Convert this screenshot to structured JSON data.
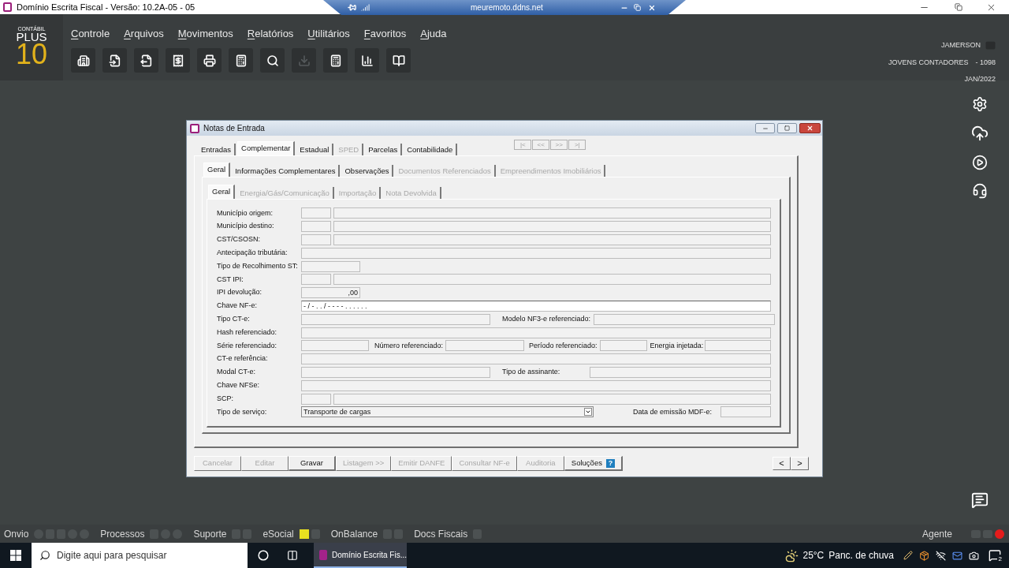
{
  "app_window": {
    "title": "Domínio Escrita Fiscal  - Versão: 10.2A-05 - 05"
  },
  "remote_bar": {
    "host": "meuremoto.ddns.net"
  },
  "logo": {
    "line1": "CONTÁBIL",
    "line2": "PLUS",
    "line3": "10"
  },
  "menu": [
    "Controle",
    "Arquivos",
    "Movimentos",
    "Relatórios",
    "Utilitários",
    "Favoritos",
    "Ajuda"
  ],
  "toolbar": [
    {
      "disabled": false
    },
    {
      "disabled": false
    },
    {
      "disabled": false
    },
    {
      "disabled": false
    },
    {
      "disabled": false
    },
    {
      "disabled": false
    },
    {
      "disabled": false
    },
    {
      "disabled": true
    },
    {
      "disabled": false
    },
    {
      "disabled": false
    },
    {
      "disabled": false
    }
  ],
  "session": {
    "user": "JAMERSON",
    "company": "JOVENS CONTADORES",
    "code": "- 1098",
    "period": "JAN/2022"
  },
  "dialog": {
    "title": "Notas de Entrada",
    "tabs": [
      {
        "label": "Entradas",
        "selected": false,
        "disabled": false
      },
      {
        "label": "Complementar",
        "selected": true,
        "disabled": false
      },
      {
        "label": "Estadual",
        "selected": false,
        "disabled": false
      },
      {
        "label": "SPED",
        "selected": false,
        "disabled": true
      },
      {
        "label": "Parcelas",
        "selected": false,
        "disabled": false
      },
      {
        "label": "Contabilidade",
        "selected": false,
        "disabled": false
      }
    ],
    "nav_buttons": [
      "|<",
      "<<",
      ">>",
      ">|"
    ],
    "subtabs": [
      {
        "label": "Geral",
        "selected": true,
        "disabled": false
      },
      {
        "label": "Informações Complementares",
        "selected": false,
        "disabled": false
      },
      {
        "label": "Observações",
        "selected": false,
        "disabled": false
      },
      {
        "label": "Documentos Referenciados",
        "selected": false,
        "disabled": true
      },
      {
        "label": "Empreendimentos Imobiliários",
        "selected": false,
        "disabled": true
      }
    ],
    "inner_tabs": [
      {
        "label": "Geral",
        "selected": true,
        "disabled": false
      },
      {
        "label": "Energia/Gás/Comunicação",
        "selected": false,
        "disabled": true
      },
      {
        "label": "Importação",
        "selected": false,
        "disabled": true
      },
      {
        "label": "Nota Devolvida",
        "selected": false,
        "disabled": true
      }
    ],
    "rows": [
      {
        "kind": "code_desc",
        "fields": [
          {
            "label": "Município origem:"
          }
        ]
      },
      {
        "kind": "code_desc",
        "fields": [
          {
            "label": "Município destino:"
          }
        ]
      },
      {
        "kind": "code_desc",
        "fields": [
          {
            "label": "CST/CSOSN:"
          }
        ]
      },
      {
        "kind": "full",
        "fields": [
          {
            "label": "Antecipação tributária:"
          }
        ]
      },
      {
        "kind": "short",
        "fields": [
          {
            "label": "Tipo de Recolhimento ST:"
          }
        ]
      },
      {
        "kind": "code_desc",
        "fields": [
          {
            "label": "CST IPI:"
          }
        ]
      },
      {
        "kind": "amount",
        "fields": [
          {
            "label": "IPI devolução:",
            "value": ",00"
          }
        ]
      },
      {
        "kind": "mask",
        "fields": [
          {
            "label": "Chave NF-e:",
            "value": "- / - .  .  /  - - - -  .  .  .  .  .  ."
          }
        ]
      },
      {
        "kind": "pair",
        "fields": [
          {
            "label": "Tipo CT-e:"
          },
          {
            "label": "Modelo NF3-e referenciado:"
          }
        ]
      },
      {
        "kind": "full",
        "fields": [
          {
            "label": "Hash referenciado:"
          }
        ]
      },
      {
        "kind": "quad",
        "fields": [
          {
            "label": "Série referenciado:"
          },
          {
            "label": "Número referenciado:"
          },
          {
            "label": "Período referenciado:"
          },
          {
            "label": "Energia injetada:"
          }
        ]
      },
      {
        "kind": "full",
        "fields": [
          {
            "label": "CT-e referência:"
          }
        ]
      },
      {
        "kind": "pair",
        "fields": [
          {
            "label": "Modal CT-e:"
          },
          {
            "label": "Tipo de assinante:"
          }
        ]
      },
      {
        "kind": "full",
        "fields": [
          {
            "label": "Chave NFSe:"
          }
        ]
      },
      {
        "kind": "code_desc",
        "fields": [
          {
            "label": "SCP:"
          }
        ]
      },
      {
        "kind": "select",
        "fields": [
          {
            "label": "Tipo de serviço:",
            "value": "Transporte de cargas"
          },
          {
            "label": "Data de emissão MDF-e:"
          }
        ]
      }
    ],
    "buttons": [
      {
        "label": "Cancelar",
        "disabled": true
      },
      {
        "label": "Editar",
        "disabled": true
      },
      {
        "label": "Gravar",
        "disabled": false
      },
      {
        "label": "Listagem >>",
        "disabled": true
      },
      {
        "label": "Emitir DANFE",
        "disabled": true
      },
      {
        "label": "Consultar NF-e",
        "disabled": true
      },
      {
        "label": "Auditoria",
        "disabled": true
      },
      {
        "label": "Soluções",
        "disabled": false,
        "help": "?"
      }
    ],
    "pager": [
      "<",
      ">"
    ]
  },
  "status_bar": {
    "items": [
      "Onvio",
      "Processos",
      "Suporte",
      "eSocial",
      "OnBalance",
      "Docs Fiscais"
    ],
    "agent": "Agente"
  },
  "taskbar": {
    "search_placeholder": "Digite aqui para pesquisar",
    "app": "Domínio Escrita Fis...",
    "temperature": "25°C",
    "weather": "Panc. de chuva",
    "notifications": "2"
  }
}
